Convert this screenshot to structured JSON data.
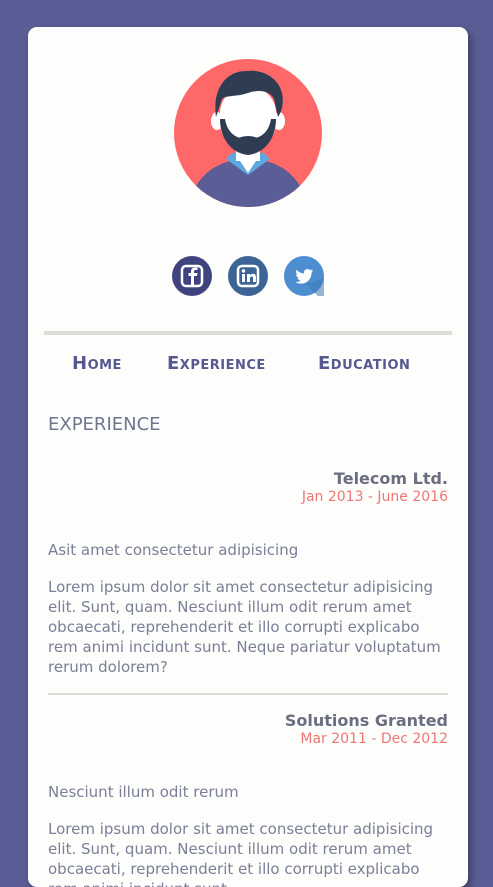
{
  "social": {
    "facebook_icon": "facebook-icon",
    "linkedin_icon": "linkedin-icon",
    "twitter_icon": "twitter-icon"
  },
  "nav": {
    "home": "Home",
    "experience": "Experience",
    "education": "Education"
  },
  "section": {
    "title": "EXPERIENCE"
  },
  "jobs": [
    {
      "company": "Telecom Ltd.",
      "dates": "Jan 2013 - June 2016",
      "subtitle": "Asit amet consectetur adipisicing",
      "description": "Lorem ipsum dolor sit amet consectetur adipisicing elit. Sunt, quam. Nesciunt illum odit rerum amet obcaecati, reprehenderit et illo corrupti explicabo rem animi incidunt sunt. Neque pariatur voluptatum rerum dolorem?"
    },
    {
      "company": "Solutions Granted",
      "dates": "Mar 2011 - Dec 2012",
      "subtitle": "Nesciunt illum odit rerum",
      "description": "Lorem ipsum dolor sit amet consectetur adipisicing elit. Sunt, quam. Nesciunt illum odit rerum amet obcaecati, reprehenderit et illo corrupti explicabo rem animi incidunt sunt."
    }
  ],
  "colors": {
    "background": "#5b5d96",
    "card": "#fdfdfb",
    "accent": "#55598f",
    "date": "#ee7776",
    "avatar_bg": "#fe6868"
  }
}
